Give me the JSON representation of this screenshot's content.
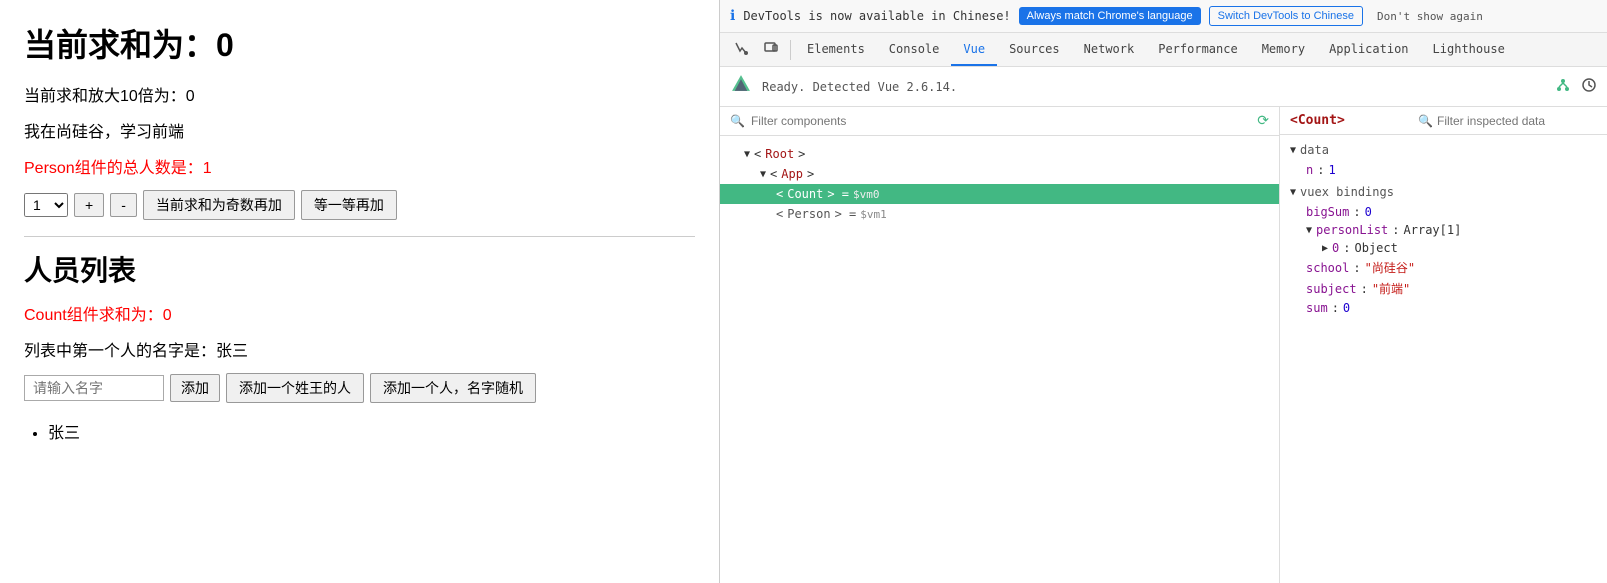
{
  "app": {
    "notification": {
      "message": "DevTools is now available in Chinese!",
      "btn_match": "Always match Chrome's language",
      "btn_switch": "Switch DevTools to Chinese",
      "btn_dismiss": "Don't show again"
    },
    "tabs": [
      {
        "label": "Elements",
        "active": false
      },
      {
        "label": "Console",
        "active": false
      },
      {
        "label": "Vue",
        "active": true
      },
      {
        "label": "Sources",
        "active": false
      },
      {
        "label": "Network",
        "active": false
      },
      {
        "label": "Performance",
        "active": false
      },
      {
        "label": "Memory",
        "active": false
      },
      {
        "label": "Application",
        "active": false
      },
      {
        "label": "Lighthouse",
        "active": false
      }
    ],
    "vue_ready": "Ready. Detected Vue 2.6.14.",
    "filter_placeholder": "Filter components",
    "filter_inspected": "Filter inspected data",
    "component_tree": [
      {
        "label": "< Root >",
        "indent": 1,
        "arrow": "▼",
        "selected": false,
        "vm": ""
      },
      {
        "label": "< App >",
        "indent": 2,
        "arrow": "▼",
        "selected": false,
        "vm": ""
      },
      {
        "label": "< Count > = $vm0",
        "indent": 3,
        "arrow": "",
        "selected": true,
        "vm": "$vm0",
        "name": "Count"
      },
      {
        "label": "< Person > = $vm1",
        "indent": 3,
        "arrow": "",
        "selected": false,
        "vm": "$vm1",
        "name": "Person"
      }
    ],
    "inspector": {
      "component_name": "<Count>",
      "data_section": "data",
      "n_label": "n",
      "n_value": "1",
      "vuex_section": "vuex bindings",
      "bigSum_label": "bigSum",
      "bigSum_value": "0",
      "personList_label": "personList",
      "personList_type": "Array[1]",
      "item0_label": "0",
      "item0_type": "Object",
      "school_label": "school",
      "school_value": "\"尚硅谷\"",
      "subject_label": "subject",
      "subject_value": "\"前端\"",
      "sum_label": "sum",
      "sum_value": "0"
    }
  },
  "left": {
    "main_title": "当前求和为：0",
    "sub_title1": "当前求和放大10倍为：0",
    "sub_title2": "我在尚硅谷，学习前端",
    "red_text1": "Person组件的总人数是：1",
    "dropdown_value": "1",
    "btn_odd": "当前求和为奇数再加",
    "btn_wait": "等一等再加",
    "btn_plus": "+",
    "btn_minus": "-",
    "section_title": "人员列表",
    "red_text2": "Count组件求和为：0",
    "first_person_label": "列表中第一个人的名字是：张三",
    "input_placeholder": "请输入名字",
    "btn_add": "添加",
    "btn_add_wang": "添加一个姓王的人",
    "btn_add_random": "添加一个人，名字随机",
    "person_list": [
      "张三"
    ]
  }
}
